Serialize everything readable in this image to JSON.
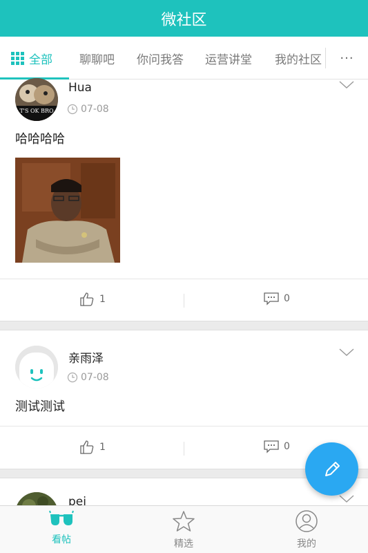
{
  "header": {
    "title": "微社区"
  },
  "tabs": [
    {
      "label": "全部",
      "active": true
    },
    {
      "label": "聊聊吧"
    },
    {
      "label": "你问我答"
    },
    {
      "label": "运营讲堂"
    },
    {
      "label": "我的社区"
    }
  ],
  "tabs_more": "···",
  "posts": [
    {
      "username": "Hua",
      "date": "07-08",
      "text": "哈哈哈哈",
      "avatar_caption": "T'S OK BRO",
      "likes": "1",
      "comments": "0"
    },
    {
      "username": "亲雨泽",
      "date": "07-08",
      "text": "测试测试",
      "likes": "1",
      "comments": "0"
    },
    {
      "username": "pei"
    }
  ],
  "bottom_nav": [
    {
      "label": "看帖",
      "icon": "glasses-icon",
      "active": true
    },
    {
      "label": "精选",
      "icon": "star-icon"
    },
    {
      "label": "我的",
      "icon": "profile-icon"
    }
  ],
  "colors": {
    "accent": "#1ec2bd",
    "fab": "#2aa8f2"
  }
}
